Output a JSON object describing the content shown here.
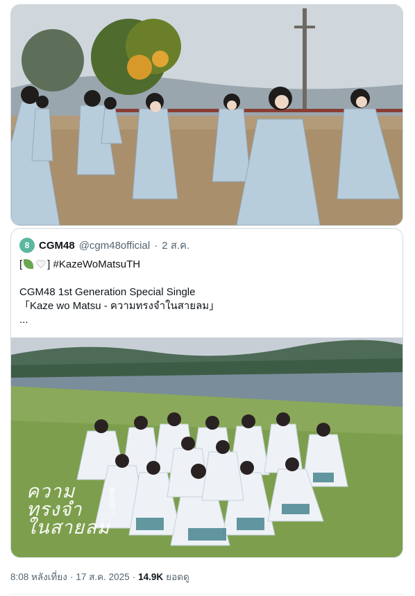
{
  "quote": {
    "author_name": "CGM48",
    "author_handle": "@cgm48official",
    "separator": "·",
    "date": "2 ส.ค.",
    "line1_open": "[",
    "line1_close": "]",
    "hashtag": "#KazeWoMatsuTH",
    "line3": "CGM48 1st Generation Special Single",
    "line4": "「Kaze wo Matsu - ความทรงจำในสายลม」",
    "ellipsis": "..."
  },
  "logo": {
    "line1": "ความ",
    "line2": "ทรงจำ",
    "line3": "ในสายลม",
    "jp": "風を待つ"
  },
  "meta": {
    "time": "8:08 หลังเที่ยง",
    "separator": "·",
    "date": "17 ส.ค. 2025",
    "separator2": "·",
    "views": "14.9K",
    "views_label": "ยอดดู"
  },
  "icons": {
    "avatar": "cgm48-avatar-icon",
    "leaf": "leaf-emoji-icon",
    "heart": "white-heart-emoji-icon"
  },
  "colors": {
    "text_primary": "#0f1419",
    "text_secondary": "#536471",
    "border": "#cfd9de",
    "costume": "#b9cfe0"
  }
}
